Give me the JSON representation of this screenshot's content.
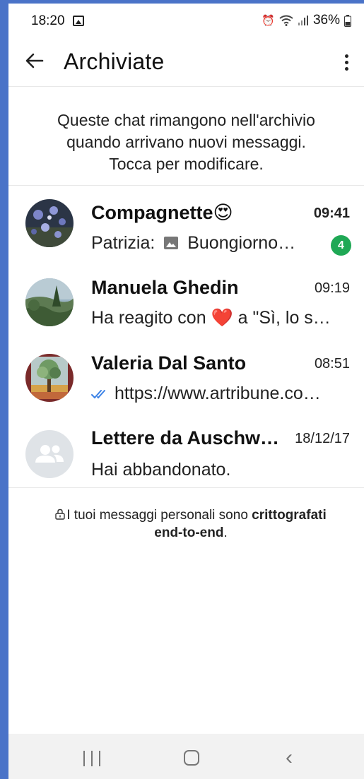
{
  "status_bar": {
    "time": "18:20",
    "battery": "36%",
    "icons": [
      "image-icon",
      "alarm-icon",
      "wifi-icon",
      "signal-icon",
      "battery-icon"
    ]
  },
  "app_bar": {
    "title": "Archiviate",
    "back_icon": "arrow-left-icon",
    "menu_icon": "more-vert-icon"
  },
  "archive_info": {
    "line1": "Queste chat rimangono nell'archivio",
    "line2": "quando arrivano nuovi messaggi.",
    "line3": "Tocca per modificare."
  },
  "chats": [
    {
      "name": "Compagnette😍",
      "time": "09:41",
      "sender": "Patrizia:",
      "preview": "Buongiorno…",
      "unread": "4",
      "avatar": "flowers-photo"
    },
    {
      "name": "Manuela Ghedin",
      "time": "09:19",
      "preview_before": "Ha reagito con",
      "reaction": "❤️",
      "preview_after": "a \"Sì, lo s…",
      "avatar": "landscape-photo"
    },
    {
      "name": "Valeria Dal Santo",
      "time": "08:51",
      "preview": "https://www.artribune.co…",
      "status_icon": "double-check-icon",
      "avatar": "tree-painting-photo"
    },
    {
      "name": "Lettere da Auschw…",
      "time": "18/12/17",
      "preview": "Hai abbandonato.",
      "avatar": "group-placeholder-icon"
    }
  ],
  "encryption_notice": {
    "text": "I tuoi messaggi personali sono ",
    "bold1": "crittografati",
    "bold2": "end-to-end",
    "suffix": "."
  },
  "colors": {
    "accent_green": "#1fa855",
    "read_check_blue": "#3b82e6",
    "frame_blue": "#4a73c8"
  }
}
